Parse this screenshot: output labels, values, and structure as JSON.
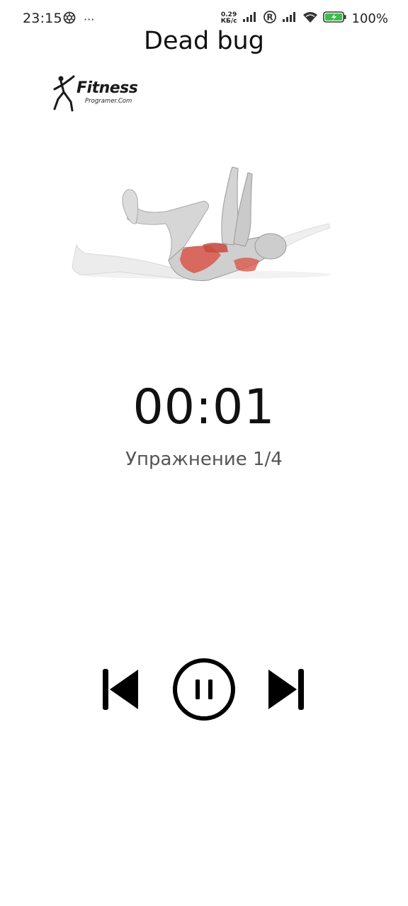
{
  "status_bar": {
    "time": "23:15",
    "more": "···",
    "net_speed_value": "0.29",
    "net_speed_unit": "КБ/с",
    "battery": "100%",
    "icons": [
      "openai-icon",
      "signal-icon",
      "registered-icon",
      "signal-icon",
      "wifi-icon",
      "battery-charging-icon"
    ]
  },
  "header": {
    "title": "Dead bug"
  },
  "logo": {
    "text": "Fitness",
    "sub": "Programer.Com"
  },
  "illustration": {
    "name": "dead-bug-exercise-illustration"
  },
  "timer": {
    "value": "00:01"
  },
  "progress": {
    "label": "Упражнение 1/4"
  },
  "controls": {
    "previous": "skip-previous-icon",
    "pause": "pause-icon",
    "next": "skip-next-icon"
  },
  "colors": {
    "background": "#ffffff",
    "text": "#111111",
    "muscle_highlight": "#d9574a"
  }
}
